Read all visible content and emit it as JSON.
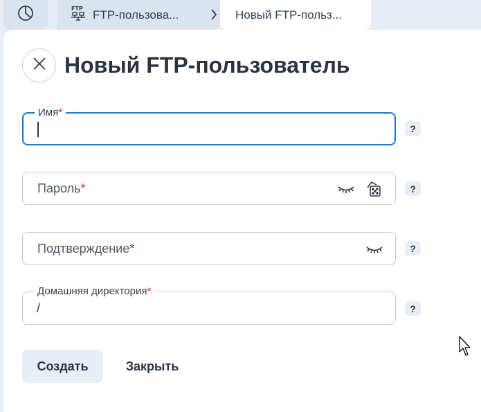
{
  "tabs": {
    "ftp_users": {
      "label": "FTP-пользова...",
      "icon": "ftp-icon"
    },
    "new_user": {
      "label": "Новый FTP-польз..."
    },
    "stats": {
      "icon": "pie-chart-icon"
    }
  },
  "page": {
    "title": "Новый FTP-пользователь"
  },
  "form": {
    "name": {
      "label": "Имя",
      "required_mark": "*",
      "value": ""
    },
    "password": {
      "placeholder": "Пароль",
      "required_mark": "*"
    },
    "confirm": {
      "placeholder": "Подтверждение",
      "required_mark": "*"
    },
    "home_dir": {
      "label": "Домашняя директория",
      "required_mark": "*",
      "value": "/"
    },
    "help_mark": "?"
  },
  "buttons": {
    "create": "Создать",
    "close": "Закрыть"
  },
  "colors": {
    "accent": "#1c79c8",
    "required": "#c3283f",
    "background": "#e8eef5"
  }
}
